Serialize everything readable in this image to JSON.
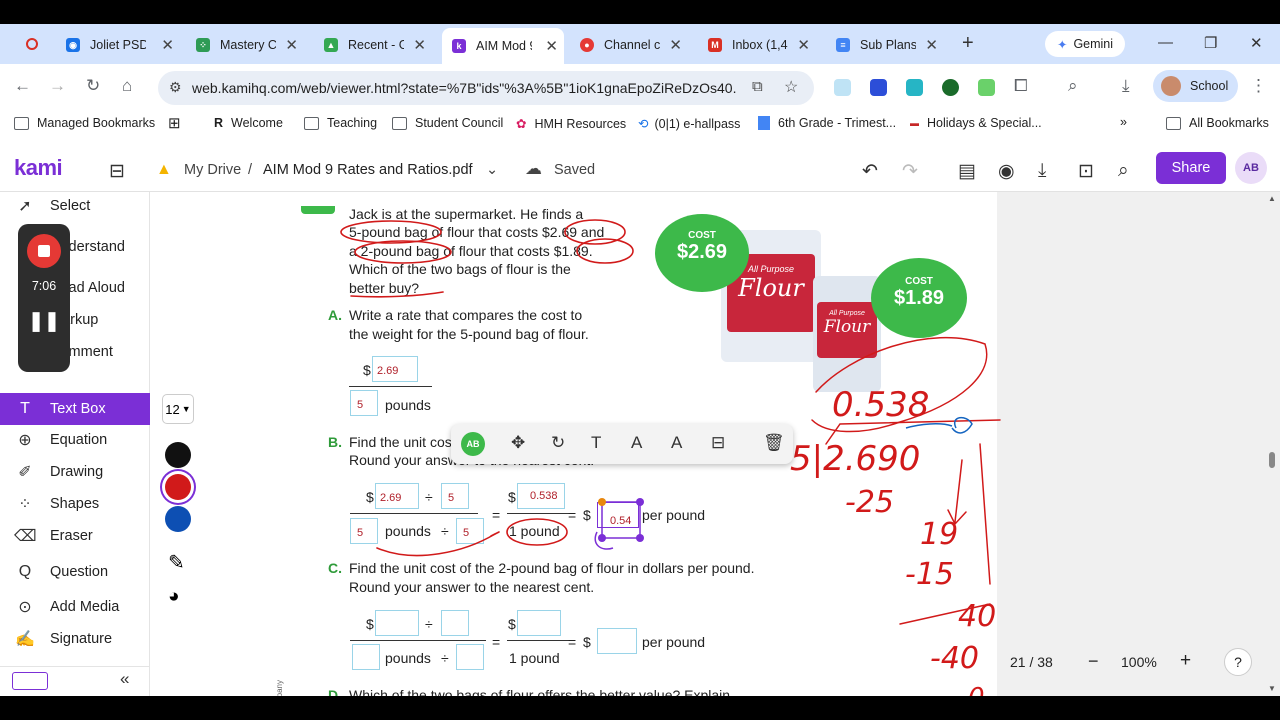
{
  "tabs": [
    {
      "label": "Joliet PSD",
      "favicon_color": "#1a73e8"
    },
    {
      "label": "Mastery C",
      "favicon_color": "#2e9b55"
    },
    {
      "label": "Recent - G",
      "favicon_color": "#34a853"
    },
    {
      "label": "AIM Mod 9",
      "favicon_color": "#7b2fd6"
    },
    {
      "label": "Channel cc",
      "favicon_color": "#e53935"
    },
    {
      "label": "Inbox (1,4",
      "favicon_color": "#d93025"
    },
    {
      "label": "Sub Plans",
      "favicon_color": "#4285f4"
    }
  ],
  "gemini_label": "Gemini",
  "url": "web.kamihq.com/web/viewer.html?state=%7B\"ids\"%3A%5B\"1ioK1gnaEpoZiReDzOs40...",
  "profile_label": "School",
  "bookmarks": [
    "Managed Bookmarks",
    "Welcome",
    "Teaching",
    "Student Council",
    "HMH Resources",
    "(0|1) e-hallpass",
    "6th Grade - Trimest...",
    "Holidays & Special...",
    "All Bookmarks"
  ],
  "kami": {
    "logo": "kami",
    "drive": "My Drive",
    "separator": "/",
    "filename": "AIM Mod 9 Rates and Ratios.pdf",
    "status": "Saved",
    "share": "Share",
    "avatar": "AB"
  },
  "tools": [
    "Select",
    "Understand",
    "Read Aloud",
    "Markup",
    "Comment",
    "Text Box",
    "Equation",
    "Drawing",
    "Shapes",
    "Eraser",
    "Question",
    "Add Media",
    "Signature"
  ],
  "active_tool": "Text Box",
  "recording_time": "7:06",
  "font_size": "12",
  "colors": [
    "#111111",
    "#d11a1a",
    "#0d4fb3"
  ],
  "problem": {
    "intro_lines": [
      "Jack is at the supermarket. He finds a",
      "5-pound bag of flour that costs $2.69 and",
      "a 2-pound bag of flour that costs $1.89.",
      "Which of the two bags of flour is the",
      "better buy?"
    ],
    "cost_label": "COST",
    "cost_a": "$2.69",
    "cost_b": "$1.89",
    "bag_text": "All Purpose",
    "bag_brand": "Flour",
    "a_letter": "A.",
    "a_lines": [
      "Write a rate that compares the cost to",
      "the weight for the 5-pound bag of flour."
    ],
    "a_num": "2.69",
    "a_den": "5",
    "pounds": "pounds",
    "dollar": "$",
    "b_letter": "B.",
    "b_lines": [
      "Find the unit cost of the 5-pound bag of flour in dollars per pound.",
      "Round your answer to the nearest cent."
    ],
    "b_vals": {
      "n1": "2.69",
      "d1": "5",
      "d2": "5",
      "d3": "5",
      "res": "0.538",
      "final": "0.54"
    },
    "one_pound": "1 pound",
    "per_pound": "per pound",
    "div": "÷",
    "eq": "=",
    "c_letter": "C.",
    "c_lines": [
      "Find the unit cost of the 2-pound bag of flour in dollars per pound.",
      "Round your answer to the nearest cent."
    ],
    "d_letter": "D.",
    "d_line": "Which of the two bags of flour offers the better value? Explain.",
    "margin_text": "mpany"
  },
  "annotation_floating_avatar": "AB",
  "page_nav": {
    "current": "21 / 38",
    "zoom": "100%",
    "help": "?"
  }
}
